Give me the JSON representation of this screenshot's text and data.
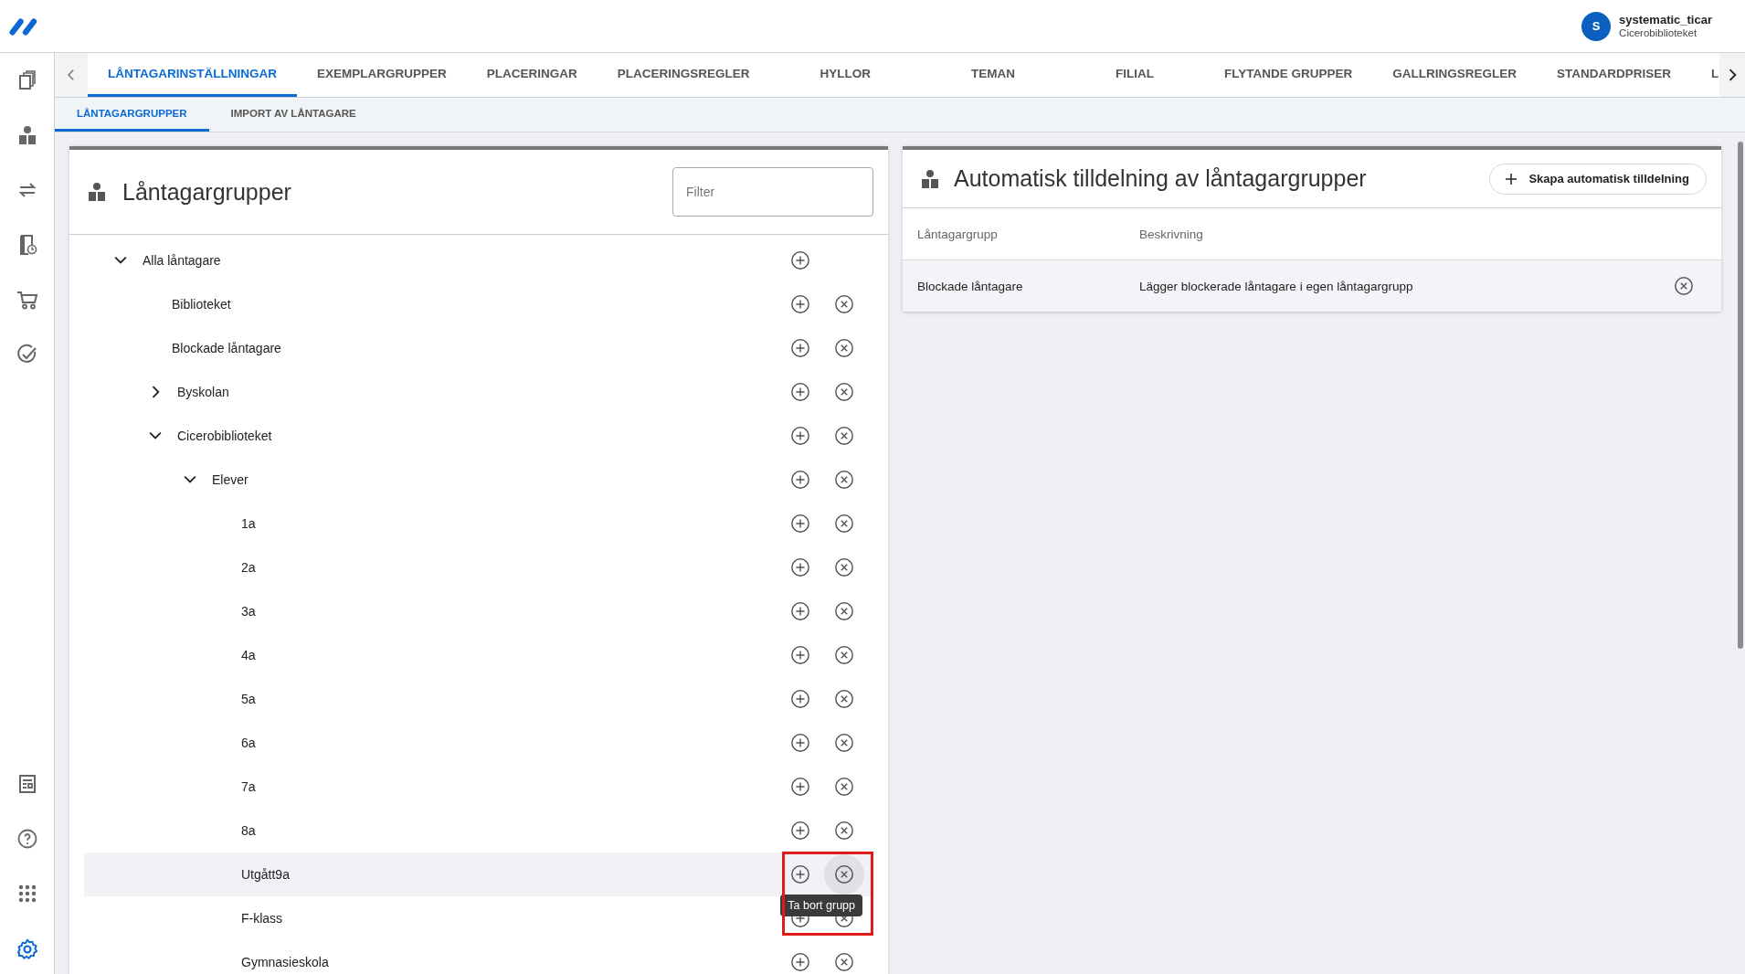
{
  "user": {
    "initial": "S",
    "name": "systematic_ticar",
    "branch": "Cicerobiblioteket"
  },
  "sidebar": {
    "items": [
      {
        "kind": "copies",
        "selected": false
      },
      {
        "kind": "borrower",
        "selected": false
      },
      {
        "kind": "transfer",
        "selected": false
      },
      {
        "kind": "overdue",
        "selected": false
      },
      {
        "kind": "cart",
        "selected": false
      },
      {
        "kind": "check",
        "selected": false
      },
      {
        "kind": "report",
        "selected": false
      },
      {
        "kind": "help",
        "selected": false
      },
      {
        "kind": "apps",
        "selected": false
      },
      {
        "kind": "settings",
        "selected": true
      }
    ]
  },
  "tabs": [
    {
      "label": "LÅNTAGARINSTÄLLNINGAR",
      "selected": true
    },
    {
      "label": "EXEMPLARGRUPPER",
      "selected": false
    },
    {
      "label": "PLACERINGAR",
      "selected": false
    },
    {
      "label": "PLACERINGSREGLER",
      "selected": false
    },
    {
      "label": "HYLLOR",
      "selected": false
    },
    {
      "label": "TEMAN",
      "selected": false
    },
    {
      "label": "FILIAL",
      "selected": false
    },
    {
      "label": "FLYTANDE GRUPPER",
      "selected": false
    },
    {
      "label": "GALLRINGSREGLER",
      "selected": false
    },
    {
      "label": "STANDARDPRISER",
      "selected": false
    },
    {
      "label": "L",
      "selected": false
    }
  ],
  "subtabs": [
    {
      "label": "LÅNTAGARGRUPPER",
      "selected": true
    },
    {
      "label": "IMPORT AV LÅNTAGARE",
      "selected": false
    }
  ],
  "left_panel": {
    "title": "Låntagargrupper",
    "filter": {
      "placeholder": "Filter"
    },
    "tree": [
      {
        "label": "Alla låntagare",
        "expanded": true,
        "removable": false,
        "children": [
          {
            "label": "Biblioteket",
            "removable": true
          },
          {
            "label": "Blockade låntagare",
            "removable": true
          },
          {
            "label": "Byskolan",
            "expanded": false,
            "removable": true
          },
          {
            "label": "Cicerobiblioteket",
            "expanded": true,
            "removable": true,
            "children": [
              {
                "label": "Elever",
                "expanded": true,
                "removable": true,
                "children": [
                  {
                    "label": "1a",
                    "removable": true
                  },
                  {
                    "label": "2a",
                    "removable": true
                  },
                  {
                    "label": "3a",
                    "removable": true
                  },
                  {
                    "label": "4a",
                    "removable": true
                  },
                  {
                    "label": "5a",
                    "removable": true
                  },
                  {
                    "label": "6a",
                    "removable": true
                  },
                  {
                    "label": "7a",
                    "removable": true
                  },
                  {
                    "label": "8a",
                    "removable": true
                  },
                  {
                    "label": "Utgått9a",
                    "removable": true,
                    "hovered": true,
                    "highlighted": true,
                    "tooltip": "Ta bort grupp"
                  },
                  {
                    "label": "F-klass",
                    "removable": true
                  },
                  {
                    "label": "Gymnasieskola",
                    "removable": true
                  }
                ]
              }
            ]
          }
        ]
      }
    ]
  },
  "right_panel": {
    "title": "Automatisk tilldelning av låntagargrupper",
    "create_button": "Skapa automatisk tilldelning",
    "columns": [
      "Låntagargrupp",
      "Beskrivning"
    ],
    "rows": [
      {
        "group": "Blockade låntagare",
        "description": "Lägger blockerade låntagare i egen låntagargrupp"
      }
    ]
  }
}
